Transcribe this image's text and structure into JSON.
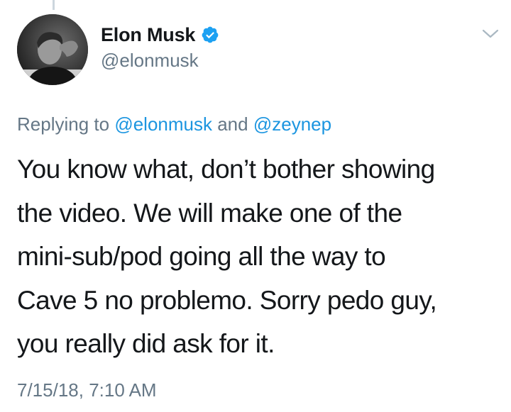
{
  "author": {
    "name": "Elon Musk",
    "handle": "@elonmusk",
    "verified": true
  },
  "reply": {
    "prefix": "Replying to",
    "mention_1": "@elonmusk",
    "conjunction": "and",
    "mention_2": "@zeynep"
  },
  "tweet": {
    "lines": [
      "You know what, don’t bother showing",
      "the video. We will make one of the",
      "mini-sub/pod going all the way to",
      "Cave 5 no problemo. Sorry pedo guy,",
      "you really did ask for it."
    ]
  },
  "timestamp": "7/15/18, 7:10 AM",
  "icons": {
    "menu": "chevron-down-icon",
    "verified": "verified-badge-icon"
  },
  "colors": {
    "link": "#1b95e0",
    "secondary_text": "#657786",
    "primary_text": "#14171a",
    "verified_badge": "#1da1f2"
  }
}
